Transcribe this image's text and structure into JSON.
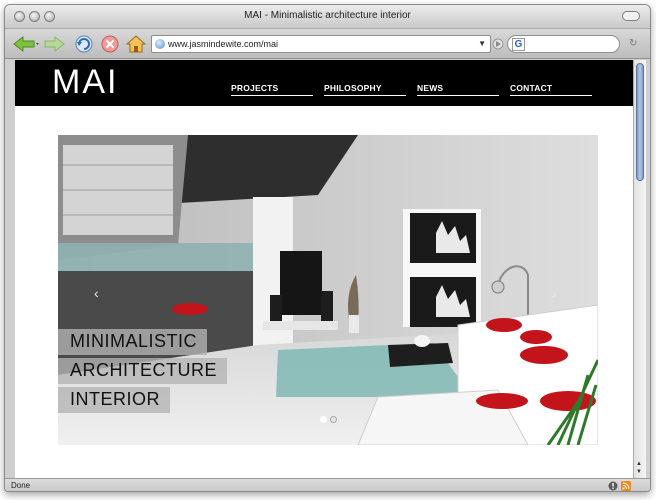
{
  "window": {
    "title": "MAI - Minimalistic architecture interior"
  },
  "toolbar": {
    "back_icon": "back-arrow-icon",
    "forward_icon": "forward-arrow-icon",
    "reload_icon": "reload-icon",
    "stop_icon": "stop-icon",
    "home_icon": "home-icon",
    "url": "www.jasmindewite.com/mai",
    "search_engine": "G"
  },
  "site": {
    "logo": "MAI",
    "nav": [
      "PROJECTS",
      "PHILOSOPHY",
      "NEWS",
      "CONTACT"
    ]
  },
  "hero": {
    "caption": [
      "MINIMALISTIC",
      "ARCHITECTURE",
      "INTERIOR"
    ],
    "prev_arrow": "‹",
    "next_arrow": "›",
    "slides_total": 2,
    "slide_active": 1
  },
  "status": {
    "text": "Done"
  },
  "colors": {
    "header_bg": "#000000",
    "nav_text": "#ffffff",
    "rug": "#7fb8b4",
    "pillow": "#c4141b"
  }
}
